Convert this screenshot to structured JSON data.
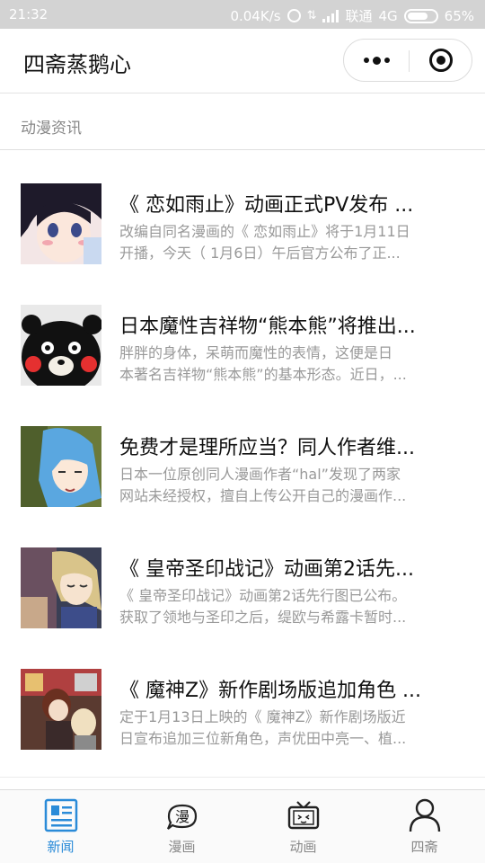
{
  "status_bar": {
    "time": "21:32",
    "network_speed": "0.04K/s",
    "carrier": "联通",
    "network_type": "4G",
    "battery": "65%"
  },
  "navbar": {
    "title": "四斋蒸鹅心"
  },
  "section": {
    "title": "动漫资讯"
  },
  "news": [
    {
      "title": "《 恋如雨止》动画正式PV发布 ...",
      "summary_line1": "改编自同名漫画的《 恋如雨止》将于1月11日",
      "summary_line2": "开播，今天（ 1月6日）午后官方公布了正..."
    },
    {
      "title": "日本魔性吉祥物“熊本熊”将推出...",
      "summary_line1": "胖胖的身体，呆萌而魔性的表情，这便是日",
      "summary_line2": "本著名吉祥物“熊本熊”的基本形态。近日，..."
    },
    {
      "title": "免费才是理所应当？同人作者维...",
      "summary_line1": "日本一位原创同人漫画作者“hal”发现了两家",
      "summary_line2": "网站未经授权，擅自上传公开自己的漫画作..."
    },
    {
      "title": "《 皇帝圣印战记》动画第2话先...",
      "summary_line1": "《 皇帝圣印战记》动画第2话先行图已公布。",
      "summary_line2": "获取了领地与圣印之后，缇欧与希露卡暂时..."
    },
    {
      "title": "《 魔神Z》新作剧场版追加角色 ...",
      "summary_line1": "定于1月13日上映的《 魔神Z》新作剧场版近",
      "summary_line2": "日宣布追加三位新角色，声优田中亮一、植..."
    }
  ],
  "tabbar": {
    "tabs": [
      {
        "label": "新闻",
        "icon": "newspaper-icon",
        "active": true
      },
      {
        "label": "漫画",
        "icon": "comic-bubble-icon",
        "active": false
      },
      {
        "label": "动画",
        "icon": "tv-icon",
        "active": false
      },
      {
        "label": "四斋",
        "icon": "person-icon",
        "active": false
      }
    ],
    "icon_glyph_comic": "漫"
  },
  "colors": {
    "accent": "#2a8bd8",
    "status_bar_bg": "#d3d3d3",
    "inactive_text": "#888888",
    "summary_text": "#999999"
  }
}
